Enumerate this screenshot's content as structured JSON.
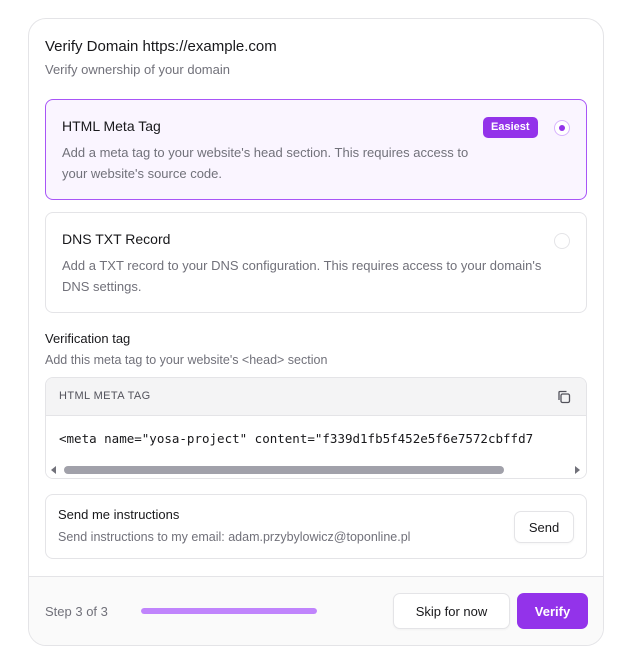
{
  "header": {
    "title": "Verify Domain https://example.com",
    "subtitle": "Verify ownership of your domain"
  },
  "options": [
    {
      "title": "HTML Meta Tag",
      "description": "Add a meta tag to your website's head section. This requires access to your website's source code.",
      "badge": "Easiest",
      "selected": true
    },
    {
      "title": "DNS TXT Record",
      "description": "Add a TXT record to your DNS configuration. This requires access to your domain's DNS settings.",
      "selected": false
    }
  ],
  "verification": {
    "label": "Verification tag",
    "description": "Add this meta tag to your website's <head> section",
    "code_header": "HTML META TAG",
    "code": "<meta name=\"yosa-project\" content=\"f339d1fb5f452e5f6e7572cbffd7"
  },
  "send": {
    "title": "Send me instructions",
    "description": "Send instructions to my email: adam.przybylowicz@toponline.pl",
    "button": "Send"
  },
  "footer": {
    "step": "Step 3 of 3",
    "progress": 1.0,
    "skip_label": "Skip for now",
    "verify_label": "Verify"
  },
  "icons": {
    "copy": "copy-icon"
  },
  "colors": {
    "accent": "#9333ea",
    "selected_bg": "#faf5ff",
    "selected_border": "#a855f7",
    "progress": "#c084fc"
  }
}
